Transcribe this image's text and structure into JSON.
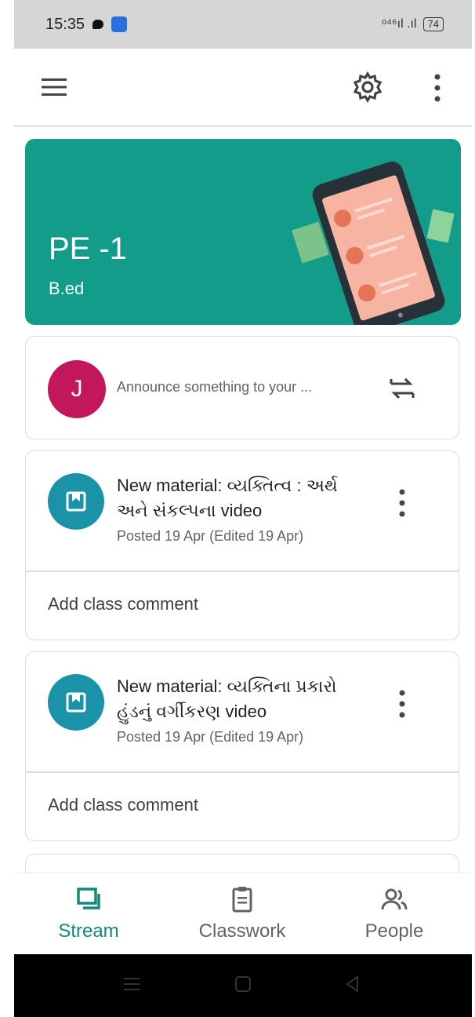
{
  "status_bar": {
    "time": "15:35",
    "signal_text": "ᵒ⁴⁶ıl .ıl",
    "battery": "74"
  },
  "app_bar": {
    "menu_icon": "hamburger-menu-icon",
    "settings_icon": "settings-gear-icon",
    "more_icon": "more-vert-icon"
  },
  "banner": {
    "title": "PE -1",
    "subtitle": "B.ed",
    "color": "#139c89"
  },
  "announce": {
    "avatar_letter": "J",
    "placeholder": "Announce something to your ...",
    "avatar_color": "#c2185b"
  },
  "posts": [
    {
      "title": "New material: વ્યક્તિત્વ : અર્થ અને સંકલ્પના video",
      "meta": "Posted 19 Apr (Edited 19 Apr)",
      "comment": "Add class comment"
    },
    {
      "title": "New material: વ્યક્તિના પ્રકારો હુંડનું વર્ગીકરણ video",
      "meta": "Posted 19 Apr (Edited 19 Apr)",
      "comment": "Add class comment"
    }
  ],
  "bottom_nav": {
    "items": [
      {
        "label": "Stream",
        "icon": "stream-icon",
        "active": true
      },
      {
        "label": "Classwork",
        "icon": "classwork-icon",
        "active": false
      },
      {
        "label": "People",
        "icon": "people-icon",
        "active": false
      }
    ],
    "active_color": "#138a79"
  },
  "system_nav": {
    "icons": [
      "recents-icon",
      "home-icon",
      "back-icon"
    ]
  }
}
